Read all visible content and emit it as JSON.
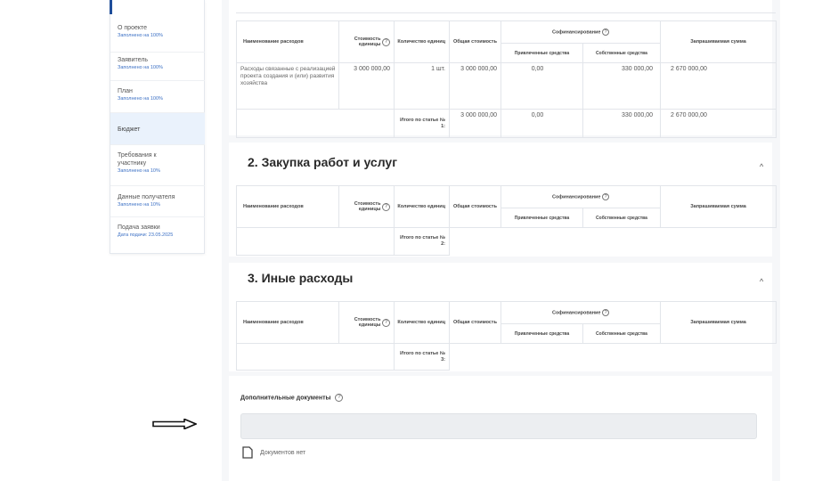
{
  "sidebar": {
    "items": [
      {
        "label": "О проекте",
        "sub": "Заполнено на 100%"
      },
      {
        "label": "Заявитель",
        "sub": "Заполнено на 100%"
      },
      {
        "label": "План",
        "sub": "Заполнено на 100%"
      },
      {
        "label": "Бюджет",
        "sub": ""
      },
      {
        "label": "Требования к участнику",
        "sub": "Заполнено на 10%"
      },
      {
        "label": "Данные получателя",
        "sub": "Заполнено на 10%"
      },
      {
        "label": "Подача заявки",
        "sub": "Дата подачи: 23.05.2025"
      }
    ]
  },
  "columns": {
    "name": "Наименование расходов",
    "unit_cost": "Стоимость единицы",
    "qty": "Количество единиц",
    "total_cost": "Общая стоимость",
    "cofin": "Софинансирование",
    "attracted": "Привлеченные средства",
    "own": "Собственные средства",
    "requested": "Запрашиваемая сумма"
  },
  "section1": {
    "row": {
      "name": "Расходы связанные с реализацией проекта создания и (или) развития хозяйства",
      "unit_cost": "3 000 000,00",
      "qty": "1 шт.",
      "total_cost": "3 000 000,00",
      "attracted": "0,00",
      "own": "330 000,00",
      "requested": "2 670 000,00"
    },
    "total_label": "Итого по статье № 1:",
    "total": {
      "total_cost": "3 000 000,00",
      "attracted": "0,00",
      "own": "330 000,00",
      "requested": "2 670 000,00"
    }
  },
  "section2": {
    "title": "2. Закупка работ и услуг",
    "total_label": "Итого по статье № 2:"
  },
  "section3": {
    "title": "3. Иные расходы",
    "total_label": "Итого по статье № 3:"
  },
  "docs": {
    "label": "Дополнительные документы",
    "empty": "Документов нет"
  }
}
